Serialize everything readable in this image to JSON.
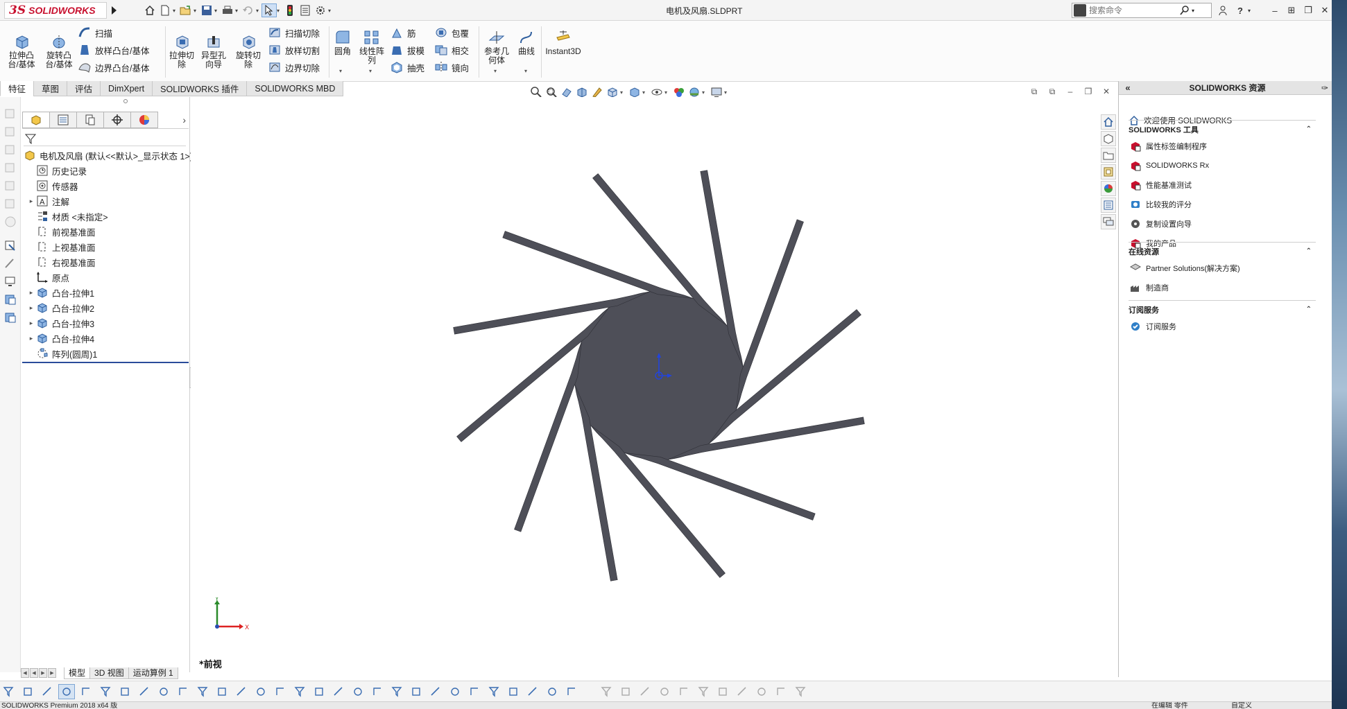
{
  "app": {
    "brand_ds": "3S",
    "brand_name": "SOLIDWORKS",
    "doc_title": "电机及风扇.SLDPRT",
    "search_placeholder": "搜索命令"
  },
  "ribbon": {
    "extrude_boss": "拉伸凸\n台/基体",
    "revolve_boss": "旋转凸\n台/基体",
    "sweep": "扫描",
    "loft_boss": "放样凸台/基体",
    "boundary_boss": "边界凸台/基体",
    "extrude_cut": "拉伸切\n除",
    "hole_wizard": "异型孔\n向导",
    "revolve_cut": "旋转切\n除",
    "sweep_cut": "扫描切除",
    "loft_cut": "放样切割",
    "boundary_cut": "边界切除",
    "fillet": "圆角",
    "linear_pattern": "线性阵\n列",
    "rib": "筋",
    "draft": "拔模",
    "shell": "抽壳",
    "wrap": "包覆",
    "intersect": "相交",
    "mirror": "镜向",
    "ref_geometry": "参考几\n何体",
    "curves": "曲线",
    "instant3d": "Instant3D"
  },
  "command_tabs": [
    "特征",
    "草图",
    "评估",
    "DimXpert",
    "SOLIDWORKS 插件",
    "SOLIDWORKS MBD"
  ],
  "feature_tree": {
    "root": "电机及风扇  (默认<<默认>_显示状态 1>)",
    "items": [
      {
        "label": "历史记录",
        "expandable": false
      },
      {
        "label": "传感器",
        "expandable": false
      },
      {
        "label": "注解",
        "expandable": true
      },
      {
        "label": "材质 <未指定>",
        "expandable": false
      },
      {
        "label": "前视基准面",
        "expandable": false
      },
      {
        "label": "上视基准面",
        "expandable": false
      },
      {
        "label": "右视基准面",
        "expandable": false
      },
      {
        "label": "原点",
        "expandable": false
      },
      {
        "label": "凸台-拉伸1",
        "expandable": true
      },
      {
        "label": "凸台-拉伸2",
        "expandable": true
      },
      {
        "label": "凸台-拉伸3",
        "expandable": true
      },
      {
        "label": "凸台-拉伸4",
        "expandable": true
      },
      {
        "label": "阵列(圆周)1",
        "expandable": false
      }
    ]
  },
  "graphics": {
    "view_label": "*前视",
    "fan_color": "#4e4f58",
    "blade_count": 12
  },
  "triad": {
    "x": "X",
    "y": "Y"
  },
  "resource_pane": {
    "title": "SOLIDWORKS 资源",
    "welcome": "欢迎使用  SOLIDWORKS",
    "sections": [
      {
        "title": "SOLIDWORKS 工具",
        "items": [
          "属性标签编制程序",
          "SOLIDWORKS Rx",
          "性能基准测试",
          "比较我的评分",
          "复制设置向导",
          "我的产品"
        ]
      },
      {
        "title": "在线资源",
        "items": [
          "Partner Solutions(解决方案)",
          "制造商"
        ]
      },
      {
        "title": "订阅服务",
        "items": [
          "订阅服务"
        ]
      }
    ]
  },
  "model_tabs": [
    "模型",
    "3D 视图",
    "运动算例 1"
  ],
  "status": {
    "left": "SOLIDWORKS Premium 2018 x64 版",
    "middle": "在编辑 零件",
    "right": "自定义"
  },
  "colors": {
    "accent": "#2a4c9a",
    "brand_red": "#c8102e"
  }
}
